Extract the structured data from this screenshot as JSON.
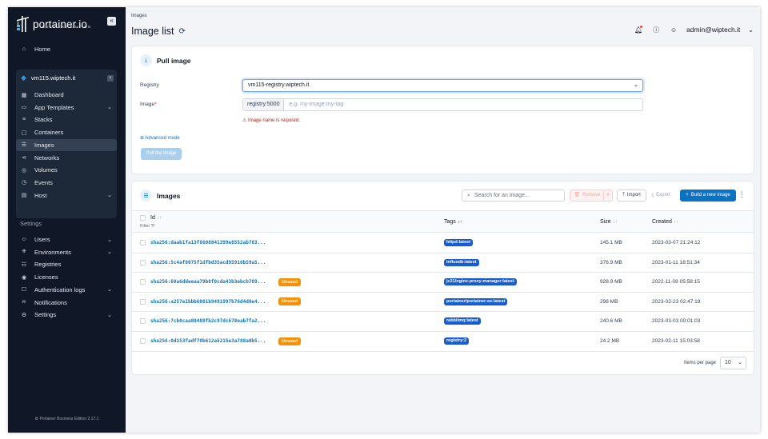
{
  "sidebar": {
    "brand": "portainer.io",
    "brand_sub": "BUSINESS EDITION",
    "collapse": "«",
    "home": "Home",
    "environment": "vm115.wiptech.it",
    "env_items": [
      {
        "label": "Dashboard",
        "icon": "dashboard-icon",
        "glyph": "▦"
      },
      {
        "label": "App Templates",
        "icon": "templates-icon",
        "glyph": "▭",
        "chevron": true
      },
      {
        "label": "Stacks",
        "icon": "stacks-icon",
        "glyph": "≡"
      },
      {
        "label": "Containers",
        "icon": "containers-icon",
        "glyph": "▢"
      },
      {
        "label": "Images",
        "icon": "images-icon",
        "glyph": "☰",
        "active": true
      },
      {
        "label": "Networks",
        "icon": "networks-icon",
        "glyph": "⋖"
      },
      {
        "label": "Volumes",
        "icon": "volumes-icon",
        "glyph": "◎"
      },
      {
        "label": "Events",
        "icon": "events-icon",
        "glyph": "◷"
      },
      {
        "label": "Host",
        "icon": "host-icon",
        "glyph": "▤",
        "chevron": true
      }
    ],
    "settings_heading": "Settings",
    "settings_items": [
      {
        "label": "Users",
        "icon": "users-icon",
        "glyph": "☺",
        "chevron": true
      },
      {
        "label": "Environments",
        "icon": "environments-icon",
        "glyph": "⎈",
        "chevron": true
      },
      {
        "label": "Registries",
        "icon": "registries-icon",
        "glyph": "☷"
      },
      {
        "label": "Licenses",
        "icon": "licenses-icon",
        "glyph": "◉"
      },
      {
        "label": "Authentication logs",
        "icon": "auth-logs-icon",
        "glyph": "☐",
        "chevron": true
      },
      {
        "label": "Notifications",
        "icon": "bell-icon",
        "glyph": "⍾"
      },
      {
        "label": "Settings",
        "icon": "gear-icon",
        "glyph": "⚙",
        "chevron": true
      }
    ],
    "footer": "⚙ Portainer Business Edition 2.17.1"
  },
  "header": {
    "breadcrumb": "Images",
    "title": "Image list",
    "user": "admin@wiptech.it"
  },
  "pull": {
    "title": "Pull image",
    "registry_label": "Registry",
    "registry_value": "vm115-registry.wiptech.it",
    "image_label": "Image",
    "image_required": "*",
    "image_prefix": "registry:5000",
    "image_placeholder": "e.g. my-image:my-tag",
    "error": "Image name is required.",
    "advanced": "Advanced mode",
    "button": "Pull the image"
  },
  "images": {
    "title": "Images",
    "search_placeholder": "Search for an image...",
    "remove": "Remove",
    "import": "Import",
    "export": "Export",
    "build": "Build a new image",
    "columns": {
      "id": "Id",
      "filter": "Filter",
      "tags": "Tags",
      "size": "Size",
      "created": "Created"
    },
    "unused_label": "Unused",
    "rows": [
      {
        "id": "sha256:daab1fa13f8608841399e8552ab783...",
        "unused": false,
        "tag": "httpd:latest",
        "size": "145.1 MB",
        "created": "2023-03-07 21:24:12"
      },
      {
        "id": "sha256:5c4af8075f1dfbd35acd95916b59a5...",
        "unused": false,
        "tag": "influxdb:latest",
        "size": "376.9 MB",
        "created": "2023-01-11 18:51:34"
      },
      {
        "id": "sha256:60a6ddeeaa79b8f0cda43b3ebcb789...",
        "unused": true,
        "tag": "jc21/nginx-proxy-manager:latest",
        "size": "928.9 MB",
        "created": "2022-11-08 05:58:15"
      },
      {
        "id": "sha256:a257e1bbb6001b9491997b76d4d0e4...",
        "unused": true,
        "tag": "portainer/portainer-ee:latest",
        "size": "298 MB",
        "created": "2023-02-23 02:47:19"
      },
      {
        "id": "sha256:7cb0caa80488fb2c97dc678eab7fa2...",
        "unused": false,
        "tag": "rabbitmq:latest",
        "size": "240.6 MB",
        "created": "2023-03-03 00:01:03"
      },
      {
        "id": "sha256:0d153fadf70b612a5215e3a788a0b5...",
        "unused": true,
        "tag": "registry:2",
        "size": "24.2 MB",
        "created": "2023-02-11 15:03:58"
      }
    ],
    "items_per_page_label": "Items per page",
    "items_per_page": "10"
  }
}
